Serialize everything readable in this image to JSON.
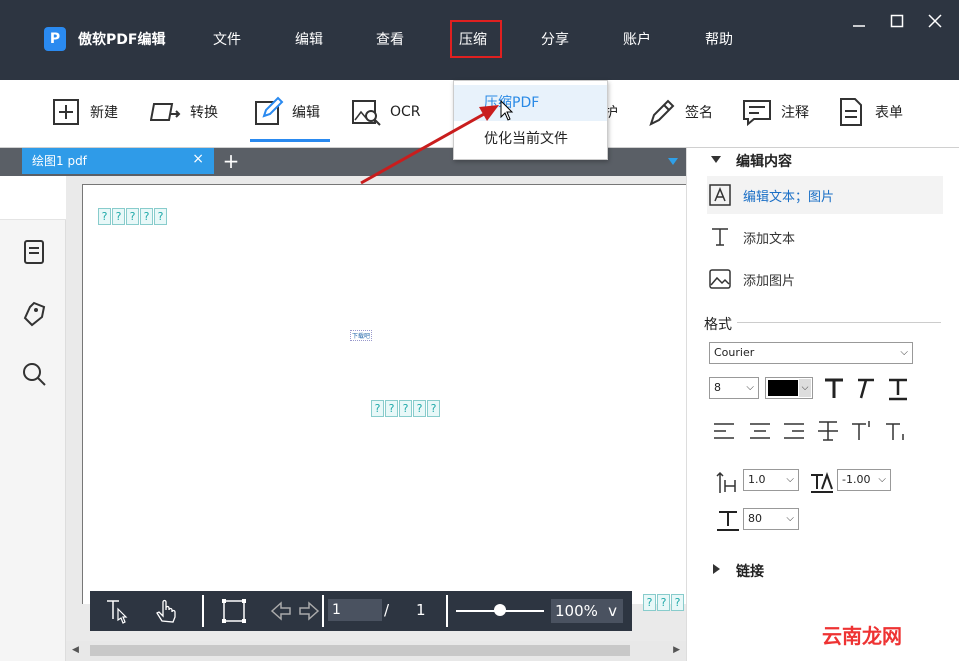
{
  "app": {
    "logo_letter": "P",
    "title": "傲软PDF编辑"
  },
  "menu": {
    "items": [
      "文件",
      "编辑",
      "查看",
      "压缩",
      "分享",
      "账户",
      "帮助"
    ],
    "highlighted": "压缩"
  },
  "toolbar": {
    "items": [
      {
        "label": "新建",
        "icon": "plus-box-icon"
      },
      {
        "label": "转换",
        "icon": "convert-icon"
      },
      {
        "label": "编辑",
        "icon": "edit-pen-icon",
        "active": true
      },
      {
        "label": "OCR",
        "icon": "ocr-icon"
      },
      {
        "label": "护",
        "icon": "protect-icon"
      },
      {
        "label": "签名",
        "icon": "signature-pen-icon"
      },
      {
        "label": "注释",
        "icon": "comment-icon"
      },
      {
        "label": "表单",
        "icon": "form-icon"
      }
    ]
  },
  "compress_menu": {
    "options": [
      "压缩PDF",
      "优化当前文件"
    ],
    "hovered": "压缩PDF"
  },
  "tabs": {
    "document_name": "绘图1 pdf",
    "close_symbol": "×",
    "add_symbol": "+"
  },
  "document": {
    "placeholder_top": "?????",
    "placeholder_middle": "?????",
    "placeholder_right": "????",
    "tiny_label": "下载吧"
  },
  "bottom_bar": {
    "current_page": "1",
    "separator": "/",
    "total_pages": "1",
    "zoom": "100%",
    "zoom_chevron": "v"
  },
  "right_panel": {
    "edit_content_heading": "编辑内容",
    "items": [
      {
        "label": "编辑文本；图片",
        "icon": "edit-text-image-icon",
        "active": true
      },
      {
        "label": "添加文本",
        "icon": "text-cursor-icon"
      },
      {
        "label": "添加图片",
        "icon": "image-icon"
      }
    ],
    "format_heading": "格式",
    "font_name": "Courier",
    "font_size": "8",
    "font_color": "#000000",
    "line_spacing": "1.0",
    "char_spacing": "-1.00",
    "scale": "80",
    "link_heading": "链接"
  },
  "watermark": "云南龙网",
  "colors": {
    "titlebar": "#2d3541",
    "accent": "#2a8af0",
    "tab_active": "#2f9be8",
    "highlight_red": "#e02020"
  }
}
